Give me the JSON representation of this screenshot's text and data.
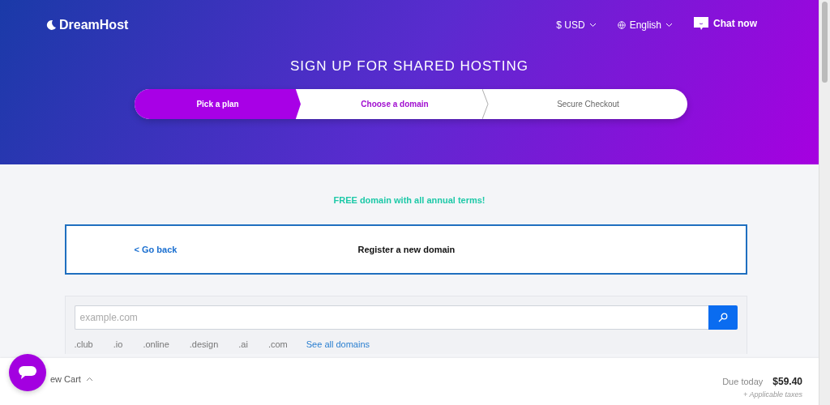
{
  "header": {
    "logo": "DreamHost",
    "currency": "$ USD",
    "language": "English",
    "chat": "Chat now"
  },
  "title": "SIGN UP FOR SHARED HOSTING",
  "steps": [
    {
      "label": "Pick a plan",
      "completed": true,
      "selected": false
    },
    {
      "label": "Choose a domain",
      "completed": false,
      "selected": true
    },
    {
      "label": "Secure Checkout",
      "completed": false,
      "selected": false
    }
  ],
  "promo": "FREE domain with all annual terms!",
  "domain_panel": {
    "back": "< Go back",
    "heading": "Register a new domain"
  },
  "search": {
    "placeholder": "example.com",
    "tlds": [
      ".club",
      ".io",
      ".online",
      ".design",
      ".ai",
      ".com"
    ],
    "all_link": "See all domains"
  },
  "cart": {
    "toggle": "ew Cart",
    "due_label": "Due today",
    "due_amount": "$59.40",
    "taxes": "+ Applicable taxes"
  }
}
